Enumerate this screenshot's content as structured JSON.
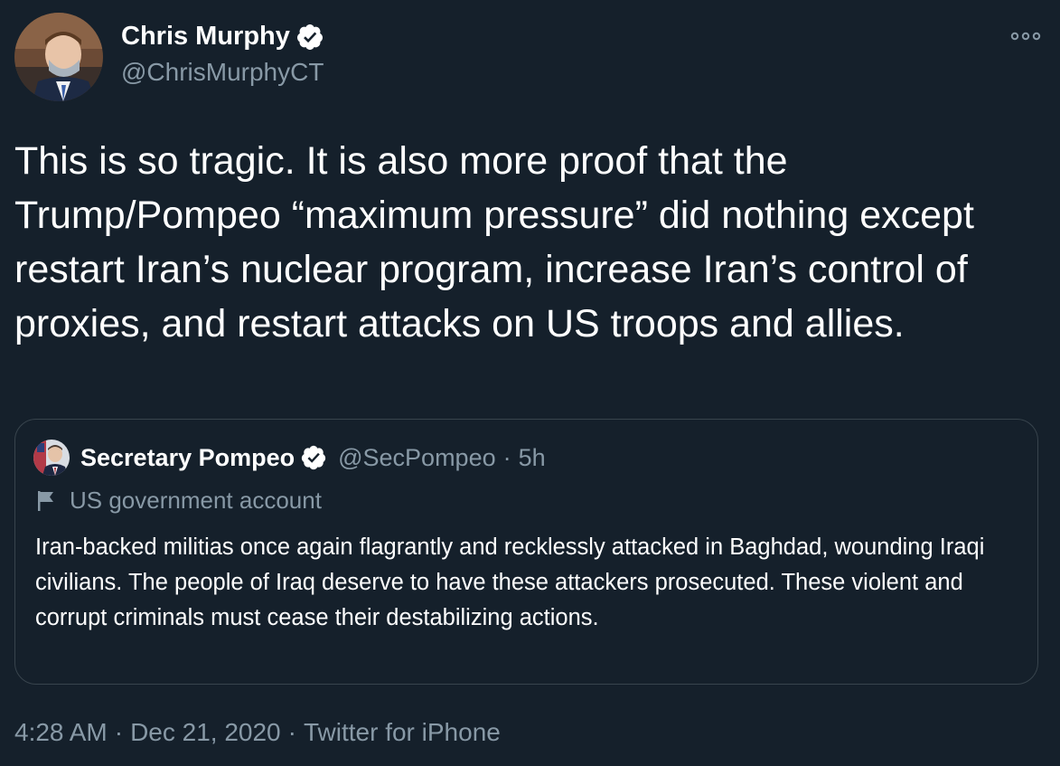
{
  "tweet": {
    "author_name": "Chris Murphy",
    "author_handle": "@ChrisMurphyCT",
    "text": "This is so tragic. It is also more proof that the Trump/Pompeo “maximum pressure” did nothing except restart Iran’s nuclear program, increase Iran’s control of proxies, and restart attacks on US troops and allies.",
    "time": "4:28 AM",
    "separator": "·",
    "date": "Dec 21, 2020",
    "source": "Twitter for iPhone",
    "more_icon": "more-dots-icon",
    "verified_icon": "verified-badge-icon"
  },
  "quoted": {
    "author_name": "Secretary Pompeo",
    "author_handle": "@SecPompeo",
    "separator": "·",
    "time_ago": "5h",
    "gov_label": "US government account",
    "gov_icon": "flag-icon",
    "text": "Iran-backed militias once again flagrantly and recklessly attacked in Baghdad, wounding Iraqi civilians. The people of Iraq deserve to have these attackers prosecuted. These violent and corrupt criminals must cease their destabilizing actions."
  },
  "colors": {
    "background": "#15202b",
    "text": "#ffffff",
    "secondary_text": "#8899a6",
    "border": "#38444d"
  }
}
